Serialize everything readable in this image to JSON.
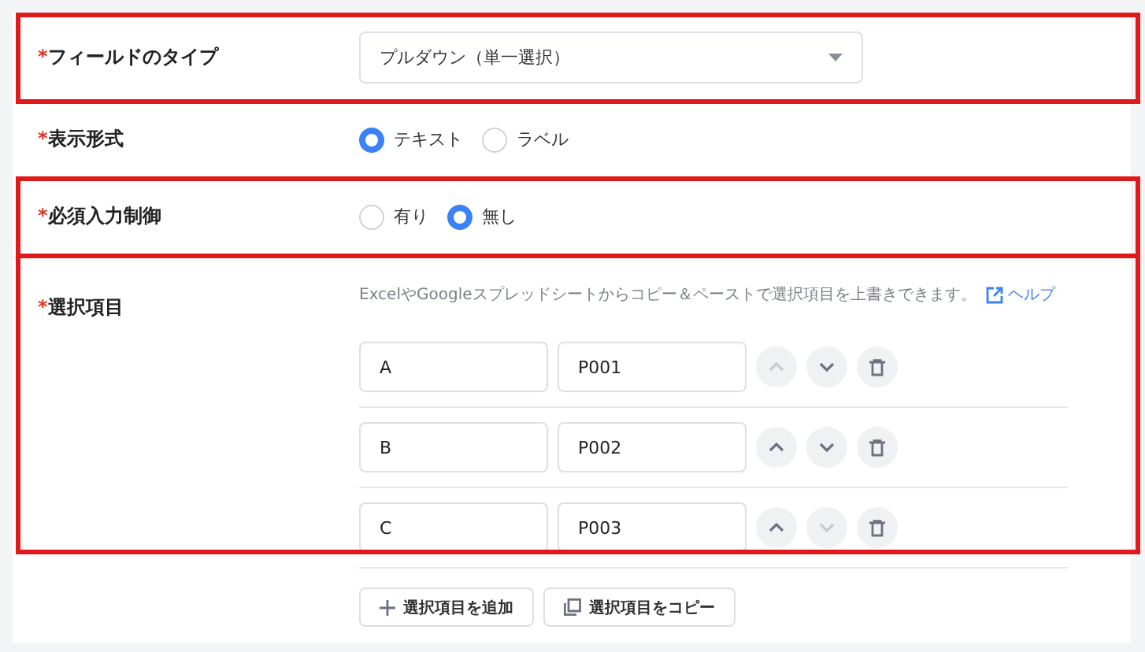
{
  "fields": [
    {
      "kind": "select",
      "mark": "*",
      "label": "フィールドのタイプ",
      "highlighted": true,
      "value": "プルダウン（単一選択）"
    },
    {
      "kind": "radio",
      "mark": "*",
      "label": "表示形式",
      "options": [
        {
          "label": "テキスト",
          "selected": true
        },
        {
          "label": "ラベル",
          "selected": false
        }
      ]
    },
    {
      "kind": "radio",
      "mark": "*",
      "label": "必須入力制御",
      "highlighted": true,
      "options": [
        {
          "label": "有り",
          "selected": false
        },
        {
          "label": "無し",
          "selected": true
        }
      ]
    },
    {
      "kind": "choices",
      "mark": "*",
      "label": "選択項目",
      "highlighted": true,
      "help": "ExcelやGoogleスプレッドシートからコピー＆ペーストで選択項目を上書きできます。",
      "help_link": "ヘルプ",
      "items": [
        {
          "label": "A",
          "code": "P001",
          "up_disabled": true,
          "down_disabled": false
        },
        {
          "label": "B",
          "code": "P002",
          "up_disabled": false,
          "down_disabled": false
        },
        {
          "label": "C",
          "code": "P003",
          "up_disabled": false,
          "down_disabled": true
        }
      ],
      "buttons": [
        {
          "kind": "add",
          "label": "選択項目を追加"
        },
        {
          "kind": "copy",
          "label": "選択項目をコピー"
        }
      ]
    }
  ]
}
